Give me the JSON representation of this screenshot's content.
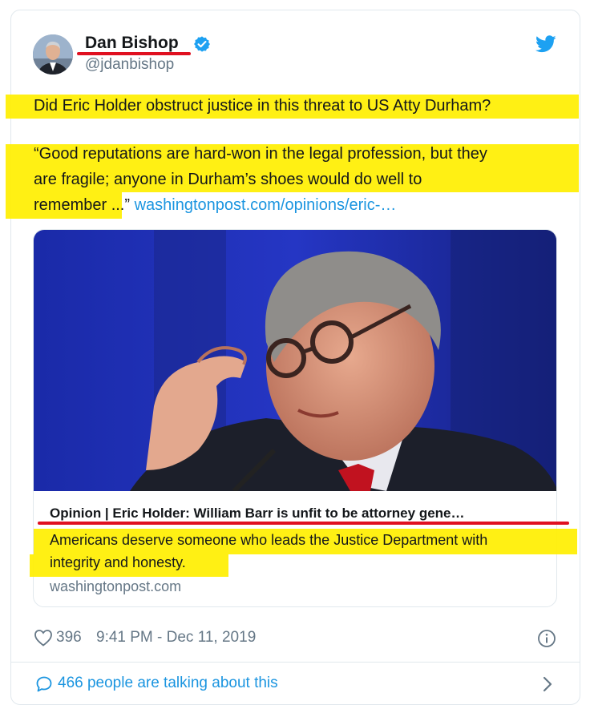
{
  "author": {
    "name": "Dan Bishop",
    "handle": "@jdanbishop"
  },
  "tweet": {
    "line1": "Did Eric Holder obstruct justice in this threat to US Atty Durham?",
    "quote_line1": "“Good reputations are hard-won in the legal profession, but they",
    "quote_line2": "are fragile; anyone in Durham’s shoes would do well to",
    "quote_line3_text": "remember ...” ",
    "link": "washingtonpost.com/opinions/eric-…"
  },
  "preview": {
    "title": "Opinion | Eric Holder: William Barr is unfit to be attorney gene…",
    "desc_line1": "Americans deserve someone who leads the Justice Department with",
    "desc_line2": "integrity and honesty.",
    "domain": "washingtonpost.com"
  },
  "footer": {
    "likes": "396",
    "timestamp": "9:41 PM - Dec 11, 2019",
    "talking": "466 people are talking about this"
  },
  "icons": {
    "verified": "verified-badge-icon",
    "twitter": "twitter-bird-icon",
    "heart": "heart-icon",
    "info": "info-icon",
    "comment": "speech-bubble-icon",
    "chevron": "chevron-right-icon"
  },
  "colors": {
    "highlight": "#ffef00",
    "underline": "#e01020",
    "twitter_blue": "#1da1f2",
    "link": "#1b95e0",
    "muted": "#657786"
  }
}
